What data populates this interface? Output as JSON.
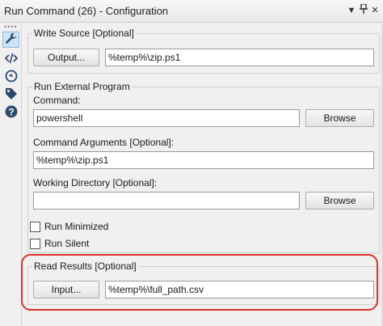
{
  "window": {
    "title": "Run Command (26) - Configuration"
  },
  "sidebar": {
    "items": [
      {
        "icon": "wrench-icon",
        "active": true
      },
      {
        "icon": "code-icon",
        "active": false
      },
      {
        "icon": "target-icon",
        "active": false
      },
      {
        "icon": "tag-icon",
        "active": false
      },
      {
        "icon": "help-icon",
        "active": false
      }
    ]
  },
  "write_source": {
    "legend": "Write Source [Optional]",
    "button_label": "Output...",
    "value": "%temp%\\zip.ps1"
  },
  "run_external": {
    "legend": "Run External Program",
    "command_label": "Command:",
    "command_value": "powershell",
    "command_browse": "Browse",
    "args_label": "Command Arguments [Optional]:",
    "args_value": "%temp%\\zip.ps1",
    "workdir_label": "Working Directory [Optional]:",
    "workdir_value": "",
    "workdir_browse": "Browse",
    "run_minimized_label": "Run Minimized",
    "run_silent_label": "Run Silent"
  },
  "read_results": {
    "legend": "Read Results [Optional]",
    "button_label": "Input...",
    "value": "%temp%\\full_path.csv"
  },
  "colors": {
    "highlight": "#d9332b",
    "active_tab": "#cfe3f7"
  }
}
